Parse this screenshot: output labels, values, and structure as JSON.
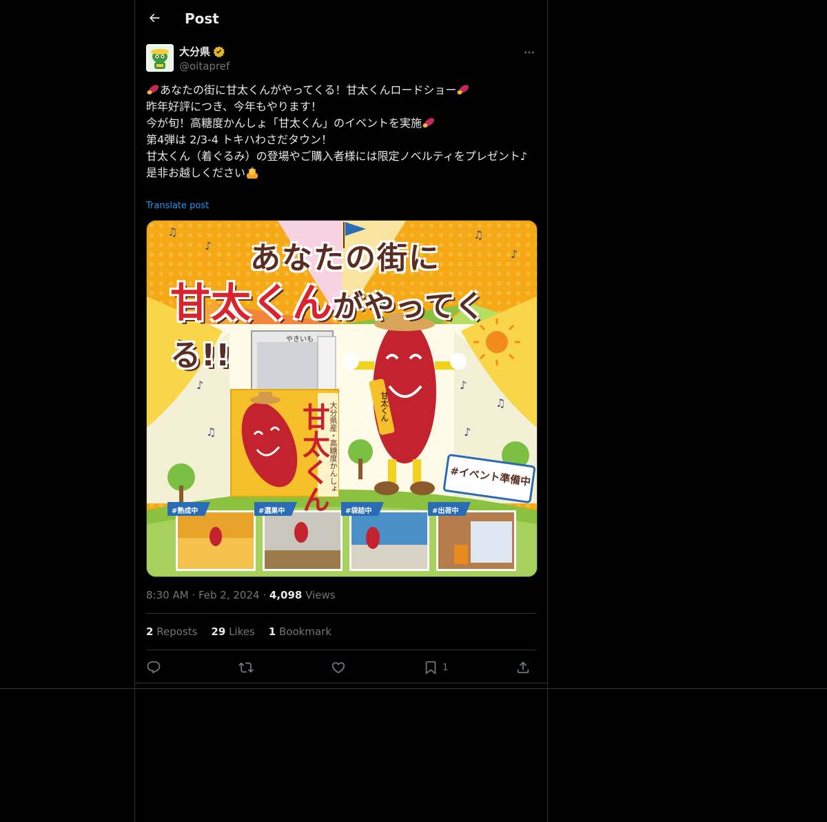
{
  "header": {
    "title": "Post"
  },
  "author": {
    "name": "大分県",
    "handle": "@oitapref"
  },
  "post": {
    "lines": [
      "あなたの街に甘太くんがやってくる！甘太くんロードショー",
      "昨年好評につき、今年もやります！",
      "今が旬！高糖度かんしょ「甘太くん」のイベントを実施",
      "第4弾は 2/3-4 トキハわさだタウン！",
      "甘太くん（着ぐるみ）の登場やご購入者様には限定ノベルティをプレゼント♪",
      "是非お越しください"
    ],
    "translate_label": "Translate post"
  },
  "poster": {
    "title_line1": "あなたの街に",
    "title_line2a": "甘太くん",
    "title_line2b": "がやってくる!!",
    "box_name": "甘太くん",
    "box_sub": "大分県産・高糖度かんしょ",
    "stand_label": "やきいも",
    "mascot_sash": "甘太くん",
    "sign": "#イベント準備中",
    "thumbs": [
      "#熟成中",
      "#選果中",
      "#袋詰中",
      "#出荷中"
    ]
  },
  "meta": {
    "time": "8:30 AM",
    "date": "Feb 2, 2024",
    "views_count": "4,098",
    "views_label": "Views"
  },
  "stats": {
    "reposts_count": "2",
    "reposts_label": "Reposts",
    "likes_count": "29",
    "likes_label": "Likes",
    "bookmarks_count": "1",
    "bookmarks_label": "Bookmark"
  },
  "actions": {
    "bookmark_count": "1"
  },
  "icons": {
    "back": "arrow-left-icon",
    "verified": "verified-badge-icon",
    "more": "more-horizontal-icon",
    "reply": "reply-icon",
    "repost": "repost-icon",
    "like": "heart-icon",
    "bookmark": "bookmark-icon",
    "share": "share-icon",
    "emoji_sweet_potato": "sweet-potato-emoji",
    "emoji_bowing": "person-bowing-emoji"
  },
  "colors": {
    "background": "#000000",
    "text": "#e7e9ea",
    "secondary": "#71767b",
    "link": "#1d9bf0",
    "border": "#2f3336",
    "verified": "#e2b719"
  }
}
